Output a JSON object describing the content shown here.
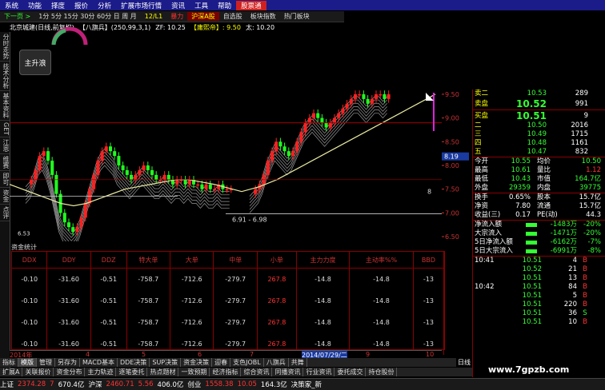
{
  "menu": [
    "系统",
    "功能",
    "择度",
    "报价",
    "分析",
    "扩展市场行情",
    "资讯",
    "工具",
    "帮助",
    "股票通"
  ],
  "menu_active": 9,
  "toolbar": {
    "items": [
      {
        "label": "下一页 >",
        "cls": "g"
      },
      {
        "label": "1分 5分 15分 30分 60分 日 周 月",
        "cls": ""
      },
      {
        "label": "12/L1",
        "cls": "y"
      },
      {
        "label": "暴力",
        "cls": "r"
      },
      {
        "label": "沪深A股",
        "cls": "hl"
      },
      {
        "label": "自选股",
        "cls": ""
      },
      {
        "label": "板块指数",
        "cls": ""
      },
      {
        "label": "热门板块",
        "cls": ""
      }
    ]
  },
  "header": {
    "stock": "北京城建(日线,前复权)",
    "indicator": "【八旗兵】(250,99,3,1)",
    "zf": "ZF: 10.25",
    "kc": "【庸熙帝】: 9.50",
    "td": "太: 10.20"
  },
  "logo": "主升浪",
  "left_tabs": [
    "分时走势",
    "技术分析",
    "基本资料",
    "GET",
    "江恩",
    "维赛",
    "即可",
    "资金",
    "点评"
  ],
  "chart": {
    "price_labels": [
      "9.50",
      "9.00",
      "8.50",
      "8.00",
      "7.50",
      "7.00",
      "6.50"
    ],
    "current_price": "8.19",
    "range_label": "6.91 - 6.98",
    "low_label": "6.53",
    "zoom_label": "8",
    "colors": {
      "up": "#ff2020",
      "down": "#20ff20",
      "ma": "#e8e8a0",
      "fill": "#ffffff"
    }
  },
  "stats": {
    "title": "资金统计",
    "headers": [
      "DDX",
      "DDY",
      "DDZ",
      "特大单",
      "大单",
      "中单",
      "小单",
      "主力力度",
      "主动率%%",
      "BBD"
    ],
    "rows": [
      [
        "-0.10",
        "-31.60",
        "-0.51",
        "-758.7",
        "-712.6",
        "-279.7",
        "267.8",
        "-14.8",
        "-14.8",
        "-13"
      ],
      [
        "-0.10",
        "-31.60",
        "-0.51",
        "-758.7",
        "-712.6",
        "-279.7",
        "267.8",
        "-14.8",
        "-14.8",
        "-13"
      ],
      [
        "-0.10",
        "-31.60",
        "-0.51",
        "-758.7",
        "-712.6",
        "-279.7",
        "267.8",
        "-14.8",
        "-14.8",
        "-13"
      ],
      [
        "-0.10",
        "-31.60",
        "-0.51",
        "-758.7",
        "-712.6",
        "-279.7",
        "267.8",
        "-14.8",
        "-14.8",
        "-13"
      ]
    ]
  },
  "xaxis": {
    "labels": [
      "2014年",
      "4",
      "5",
      "6",
      "7",
      "2014/07/29/二",
      "9",
      "10"
    ]
  },
  "bottom_tabs1": [
    "指标",
    "模版",
    "管理",
    "另存为",
    "MACD基本",
    "DDE决策",
    "SUP决策",
    "资金决策",
    "迎春",
    "支色JOBL",
    "八旗兵",
    "共舞"
  ],
  "bottom_tabs1_active": 1,
  "bottom_tabs2": [
    "扩展A",
    "关联报价",
    "资金分布",
    "主力轨迹",
    "逐笔委托",
    "热点题材",
    "一致预期",
    "经济指标",
    "综合资讯",
    "同播资讯",
    "行业资讯",
    "委托成交",
    "持仓股份"
  ],
  "bottom_right": "日线",
  "status": {
    "items": [
      {
        "t": "上证",
        "c": "wht"
      },
      {
        "t": "2374.28",
        "c": "red"
      },
      {
        "t": "7",
        "c": "red"
      },
      {
        "t": "670.4亿",
        "c": "wht"
      },
      {
        "t": "沪深",
        "c": "wht"
      },
      {
        "t": "2460.71",
        "c": "red"
      },
      {
        "t": "5.56",
        "c": "red"
      },
      {
        "t": "406.0亿",
        "c": "wht"
      },
      {
        "t": "创业",
        "c": "wht"
      },
      {
        "t": "1558.38",
        "c": "red"
      },
      {
        "t": "10.05",
        "c": "red"
      },
      {
        "t": "164.3亿",
        "c": "wht"
      },
      {
        "t": "决策家_新",
        "c": "wht"
      }
    ]
  },
  "quote": {
    "sell": [
      {
        "l": "卖二",
        "p": "10.53",
        "v": "289"
      },
      {
        "l": "卖盘",
        "p": "10.52",
        "v": "991"
      }
    ],
    "buy": [
      {
        "l": "买盘",
        "p": "10.51",
        "v": "9"
      },
      {
        "l": "二",
        "p": "10.50",
        "v": "2016"
      },
      {
        "l": "三",
        "p": "10.49",
        "v": "1715"
      },
      {
        "l": "四",
        "p": "10.48",
        "v": "1161"
      },
      {
        "l": "五",
        "p": "10.47",
        "v": "832"
      }
    ],
    "info": [
      [
        "今开",
        "10.55",
        "均价",
        "10.50"
      ],
      [
        "最高",
        "10.61",
        "量比",
        "1.12"
      ],
      [
        "最低",
        "10.43",
        "市值",
        "164.7亿"
      ],
      [
        "外盘",
        "29359",
        "内盘",
        "39775"
      ]
    ],
    "info2": [
      [
        "换手",
        "0.65%",
        "股本",
        "15.7亿"
      ],
      [
        "净资",
        "7.80",
        "流通",
        "15.7亿"
      ],
      [
        "收益(三)",
        "0.17",
        "PE(动)",
        "44.3"
      ]
    ],
    "flows": [
      {
        "l": "净流入额",
        "v": "-1483万",
        "p": "-20%"
      },
      {
        "l": "大宗流入",
        "v": "-1471万",
        "p": "-20%"
      },
      {
        "l": "5日净流入额",
        "v": "-6162万",
        "p": "-7%"
      },
      {
        "l": "5日大宗流入",
        "v": "-6991万",
        "p": "-8%"
      }
    ],
    "ticks": [
      {
        "t": "10:41",
        "p": "10.51",
        "q": "4",
        "s": "B",
        "c": "red"
      },
      {
        "t": "",
        "p": "10.52",
        "q": "21",
        "s": "B",
        "c": "red"
      },
      {
        "t": "",
        "p": "10.51",
        "q": "13",
        "s": "B",
        "c": "red"
      },
      {
        "t": "10:42",
        "p": "10.51",
        "q": "84",
        "s": "B",
        "c": "red"
      },
      {
        "t": "",
        "p": "10.51",
        "q": "5",
        "s": "B",
        "c": "red"
      },
      {
        "t": "",
        "p": "10.51",
        "q": "220",
        "s": "B",
        "c": "red"
      },
      {
        "t": "",
        "p": "10.51",
        "q": "36",
        "s": "S",
        "c": "grn"
      },
      {
        "t": "",
        "p": "10.51",
        "q": "10",
        "s": "B",
        "c": "red"
      }
    ]
  },
  "watermark": "www.7gpzb.com"
}
